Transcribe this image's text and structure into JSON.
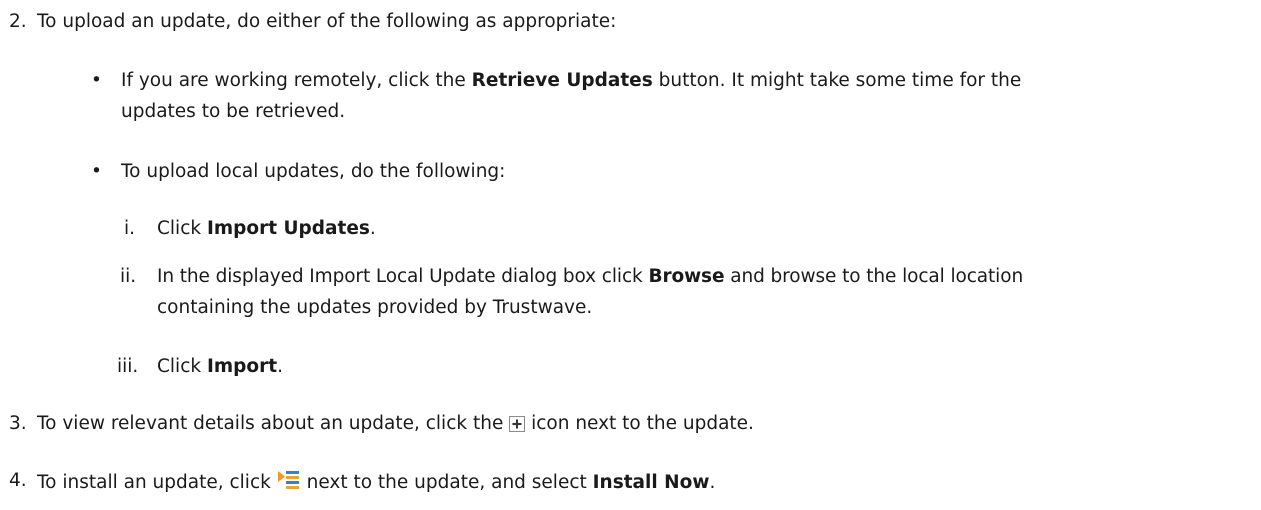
{
  "step2": {
    "number": "2.",
    "text": "To upload an update, do either of the following as appropriate:",
    "bullet_symbol": "•",
    "bullet1": {
      "pre": "If you are working remotely, click the ",
      "bold": "Retrieve Updates",
      "post": " button. It might take some time for the",
      "line2": "updates to be retrieved."
    },
    "bullet2": {
      "text": "To upload local updates, do the following:",
      "sub_i": {
        "numeral": "i.",
        "pre": "Click ",
        "bold": "Import Updates",
        "post": "."
      },
      "sub_ii": {
        "numeral": "ii.",
        "pre": "In the displayed Import Local Update dialog box click ",
        "bold": "Browse",
        "post": " and browse to the local location",
        "line2": "containing the updates provided by Trustwave."
      },
      "sub_iii": {
        "numeral": "iii.",
        "pre": "Click ",
        "bold": "Import",
        "post": "."
      }
    }
  },
  "step3": {
    "number": "3.",
    "pre": "To view relevant details about an update, click the ",
    "icon": "expand-plus-icon",
    "post": " icon next to the update."
  },
  "step4": {
    "number": "4.",
    "pre": "To install an update, click ",
    "icon": "actions-menu-icon",
    "mid": " next to the update, and select ",
    "bold": "Install Now",
    "post": "."
  }
}
